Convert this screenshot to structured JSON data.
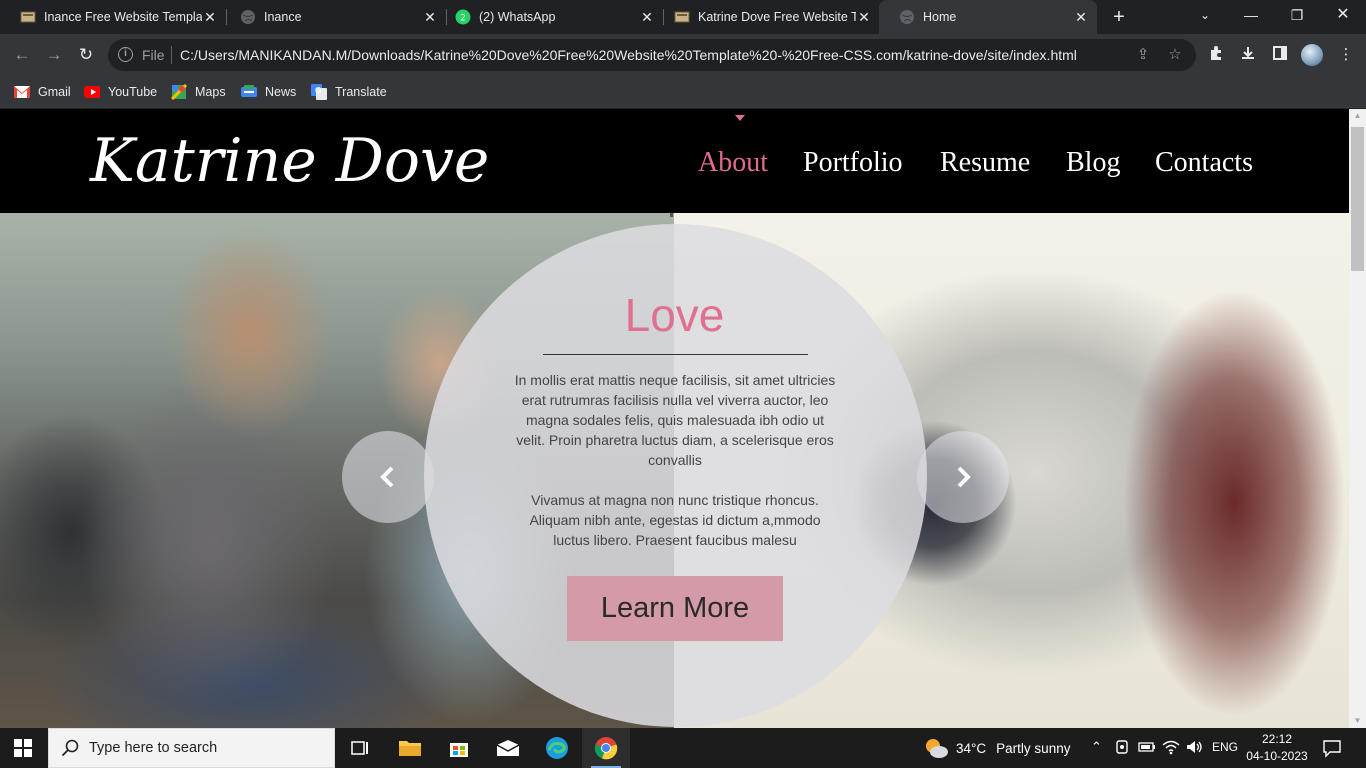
{
  "browser": {
    "tabs": [
      {
        "title": "Inance Free Website Templat",
        "active": false
      },
      {
        "title": "Inance",
        "active": false
      },
      {
        "title": "(2) WhatsApp",
        "active": false
      },
      {
        "title": "Katrine Dove Free Website T",
        "active": false
      },
      {
        "title": "Home",
        "active": true
      }
    ],
    "omnibox": {
      "scheme_label": "File",
      "url": "C:/Users/MANIKANDAN.M/Downloads/Katrine%20Dove%20Free%20Website%20Template%20-%20Free-CSS.com/katrine-dove/site/index.html"
    },
    "bookmarks": [
      {
        "label": "Gmail",
        "icon": "gmail-icon"
      },
      {
        "label": "YouTube",
        "icon": "youtube-icon"
      },
      {
        "label": "Maps",
        "icon": "maps-icon"
      },
      {
        "label": "News",
        "icon": "news-icon"
      },
      {
        "label": "Translate",
        "icon": "translate-icon"
      }
    ]
  },
  "site": {
    "logo": "Katrine Dove",
    "nav": [
      {
        "label": "About",
        "active": true
      },
      {
        "label": "Portfolio",
        "active": false
      },
      {
        "label": "Resume",
        "active": false
      },
      {
        "label": "Blog",
        "active": false
      },
      {
        "label": "Contacts",
        "active": false
      }
    ],
    "hero": {
      "title": "Love",
      "paragraph1": "In mollis erat mattis neque facilisis, sit amet ultricies erat rutrumras facilisis nulla vel viverra auctor, leo magna sodales felis, quis malesuada ibh odio ut velit. Proin pharetra luctus diam, a scelerisque eros convallis",
      "paragraph2": "Vivamus at magna non nunc tristique rhoncus. Aliquam nibh ante, egestas id dictum a,mmodo luctus libero. Praesent faucibus malesu",
      "button": "Learn More"
    },
    "colors": {
      "accent": "#e07090",
      "button": "#d49aa8",
      "header": "#000000"
    }
  },
  "taskbar": {
    "search_placeholder": "Type here to search",
    "weather": {
      "temp": "34°C",
      "condition": "Partly sunny"
    },
    "language": "ENG",
    "time": "22:12",
    "date": "04-10-2023"
  }
}
